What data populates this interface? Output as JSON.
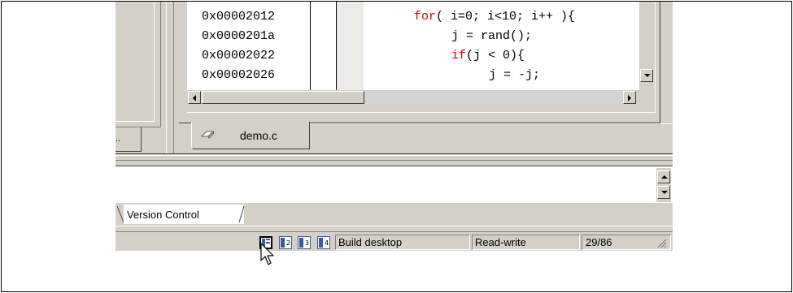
{
  "editor": {
    "addresses": [
      "0x00002012",
      "0x0000201a",
      "0x00002022",
      "0x00002026"
    ],
    "code_lines": [
      {
        "kw": "for",
        "rest": "( i=0; i<10; i++ ){"
      },
      {
        "kw": "",
        "rest": "j = rand();"
      },
      {
        "kw": "if",
        "rest": "(j < 0){"
      },
      {
        "kw": "",
        "rest": "j = -j;"
      }
    ]
  },
  "file_tab": {
    "label": "demo.c",
    "icon": "source-file-icon"
  },
  "left_panel_tab": {
    "label": ".."
  },
  "output_tabs": {
    "active": "Version Control"
  },
  "status_bar": {
    "layout_buttons": [
      "layout-1-icon",
      "layout-2-icon",
      "layout-3-icon",
      "layout-4-icon"
    ],
    "mode": "Build desktop",
    "access": "Read-write",
    "position": "29/86"
  },
  "colors": {
    "keyword": "#e00000",
    "chrome": "#d4d0c8"
  }
}
